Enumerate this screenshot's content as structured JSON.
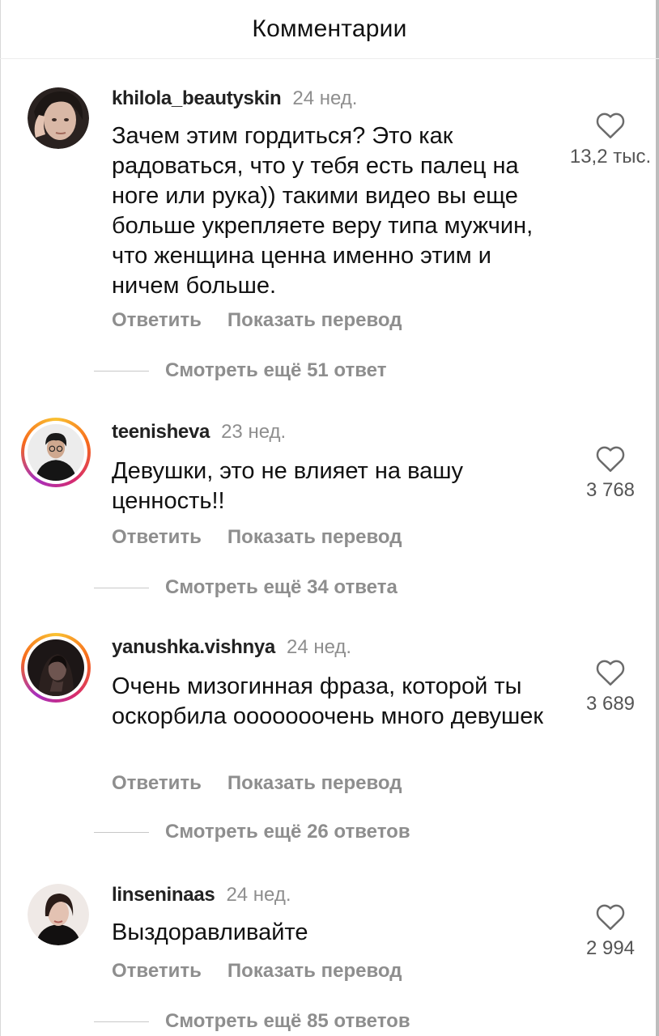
{
  "header": {
    "title": "Комментарии"
  },
  "comments": [
    {
      "username": "khilola_beautyskin",
      "time": "24 нед.",
      "text": "Зачем этим гордиться? Это  как радоваться, что у тебя есть палец на ноге или рука)) такими видео вы еще больше укрепляете веру типа мужчин, что женщина ценна именно этим и ничем больше.",
      "likes": "13,2 тыс.",
      "reply": "Ответить",
      "translate": "Показать перевод",
      "view_replies": "Смотреть ещё 51 ответ"
    },
    {
      "username": "teenisheva",
      "time": "23 нед.",
      "text": "Девушки, это не влияет на вашу ценность!!",
      "likes": "3 768",
      "reply": "Ответить",
      "translate": "Показать перевод",
      "view_replies": "Смотреть ещё 34 ответа"
    },
    {
      "username": "yanushka.vishnya",
      "time": "24 нед.",
      "text": "Очень мизогинная фраза, которой ты оскорбила оооооoочень много девушек",
      "likes": "3 689",
      "reply": "Ответить",
      "translate": "Показать перевод",
      "view_replies": "Смотреть ещё 26 ответов"
    },
    {
      "username": "linseninaas",
      "time": "24 нед.",
      "text": "Выздоравливайте",
      "likes": "2 994",
      "reply": "Ответить",
      "translate": "Показать перевод",
      "view_replies": "Смотреть ещё 85 ответов"
    }
  ]
}
